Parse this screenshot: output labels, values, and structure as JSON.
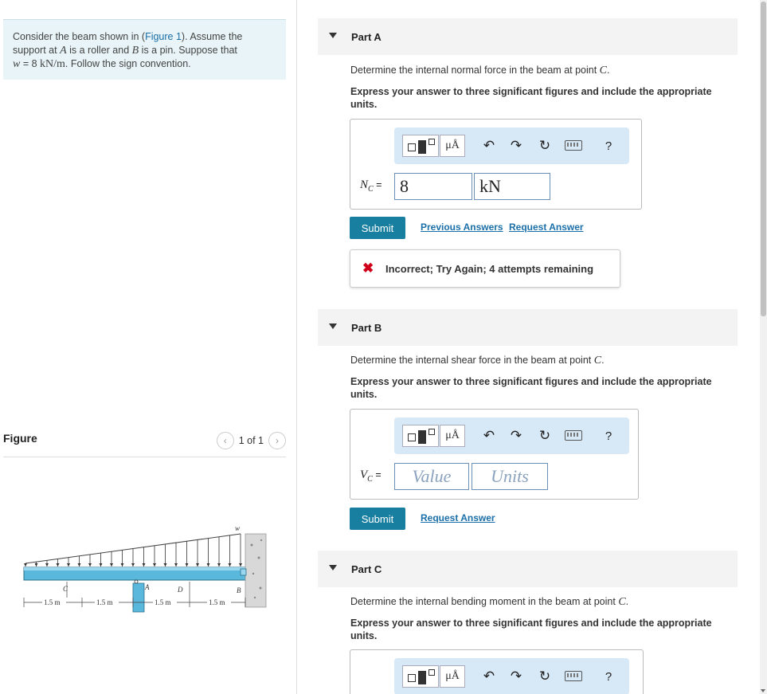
{
  "problem": {
    "t1": "Consider the beam shown in (",
    "figure_link": "Figure 1",
    "t2": "). Assume the support at ",
    "A": "A",
    "t3": " is a roller and ",
    "B": "B",
    "t4": " is a pin. Suppose that ",
    "w": "w",
    "t5": " = 8 ",
    "unit": "kN/m",
    "t6": ". Follow the sign convention."
  },
  "figure": {
    "title": "Figure",
    "pager_text": "1 of 1",
    "labels": {
      "w": "w",
      "A": "A",
      "B": "B",
      "C": "C",
      "D": "D"
    },
    "dims": [
      "1.5 m",
      "1.5 m",
      "1.5 m",
      "1.5 m"
    ]
  },
  "parts": [
    {
      "label": "Part A",
      "question_prefix": "Determine the internal normal force in the beam at point ",
      "question_var": "C",
      "question_suffix": ".",
      "instruction": "Express your answer to three significant figures and include the appropriate units.",
      "lhs_var": "N",
      "lhs_sub": "C",
      "lhs_eq": " =",
      "value": "8",
      "units": "kN",
      "submit": "Submit",
      "prev_answers": "Previous Answers",
      "request_answer": "Request Answer",
      "feedback": "Incorrect; Try Again; 4 attempts remaining"
    },
    {
      "label": "Part B",
      "question_prefix": "Determine the internal shear force in the beam at point ",
      "question_var": "C",
      "question_suffix": ".",
      "instruction": "Express your answer to three significant figures and include the appropriate units.",
      "lhs_var": "V",
      "lhs_sub": "C",
      "lhs_eq": " =",
      "value_placeholder": "Value",
      "units_placeholder": "Units",
      "submit": "Submit",
      "request_answer": "Request Answer"
    },
    {
      "label": "Part C",
      "question_prefix": "Determine the internal bending moment in the beam at point ",
      "question_var": "C",
      "question_suffix": ".",
      "instruction": "Express your answer to three significant figures and include the appropriate units."
    }
  ],
  "toolbar": {
    "mu_label": "μÅ",
    "help": "?",
    "undo_icon": "undo-icon",
    "redo_icon": "redo-icon",
    "reset_icon": "reset-icon",
    "keyboard_icon": "keyboard-icon"
  },
  "colors": {
    "submit_bg": "#197fa0",
    "link": "#1a6fa8",
    "error": "#d0021b",
    "problem_bg": "#e8f4f7",
    "toolbar_bg": "#d7e8f6"
  }
}
